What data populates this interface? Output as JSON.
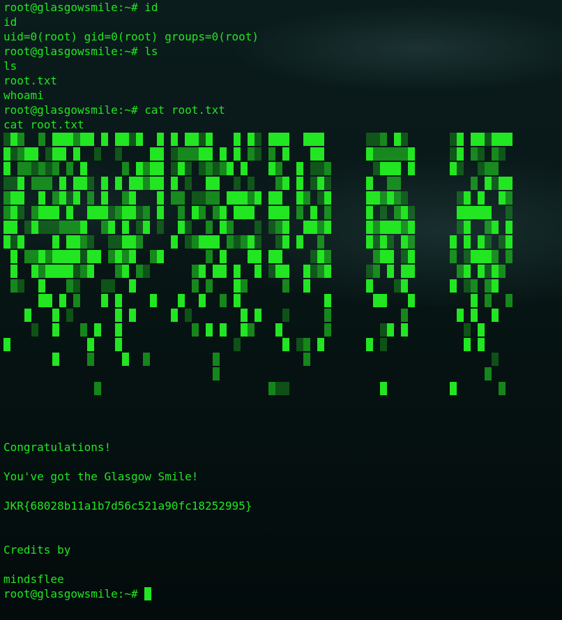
{
  "terminal": {
    "text_color": "#22e622",
    "background": "#061414",
    "lines": [
      "root@glasgowsmile:~# id",
      "id",
      "uid=0(root) gid=0(root) groups=0(root)",
      "root@glasgowsmile:~# ls",
      "ls",
      "root.txt",
      "whoami",
      "root@glasgowsmile:~# cat root.txt",
      "cat root.txt"
    ],
    "footer": {
      "congrats": "Congratulations!",
      "smile": "You've got the Glasgow Smile!",
      "flag": "JKR{68028b11a1b7d56c521a90fc18252995}",
      "credits_label": "Credits by",
      "credits_name": "mindsflee",
      "prompt": "root@glasgowsmile:~# "
    },
    "cursor_icon": "block-cursor-icon"
  }
}
